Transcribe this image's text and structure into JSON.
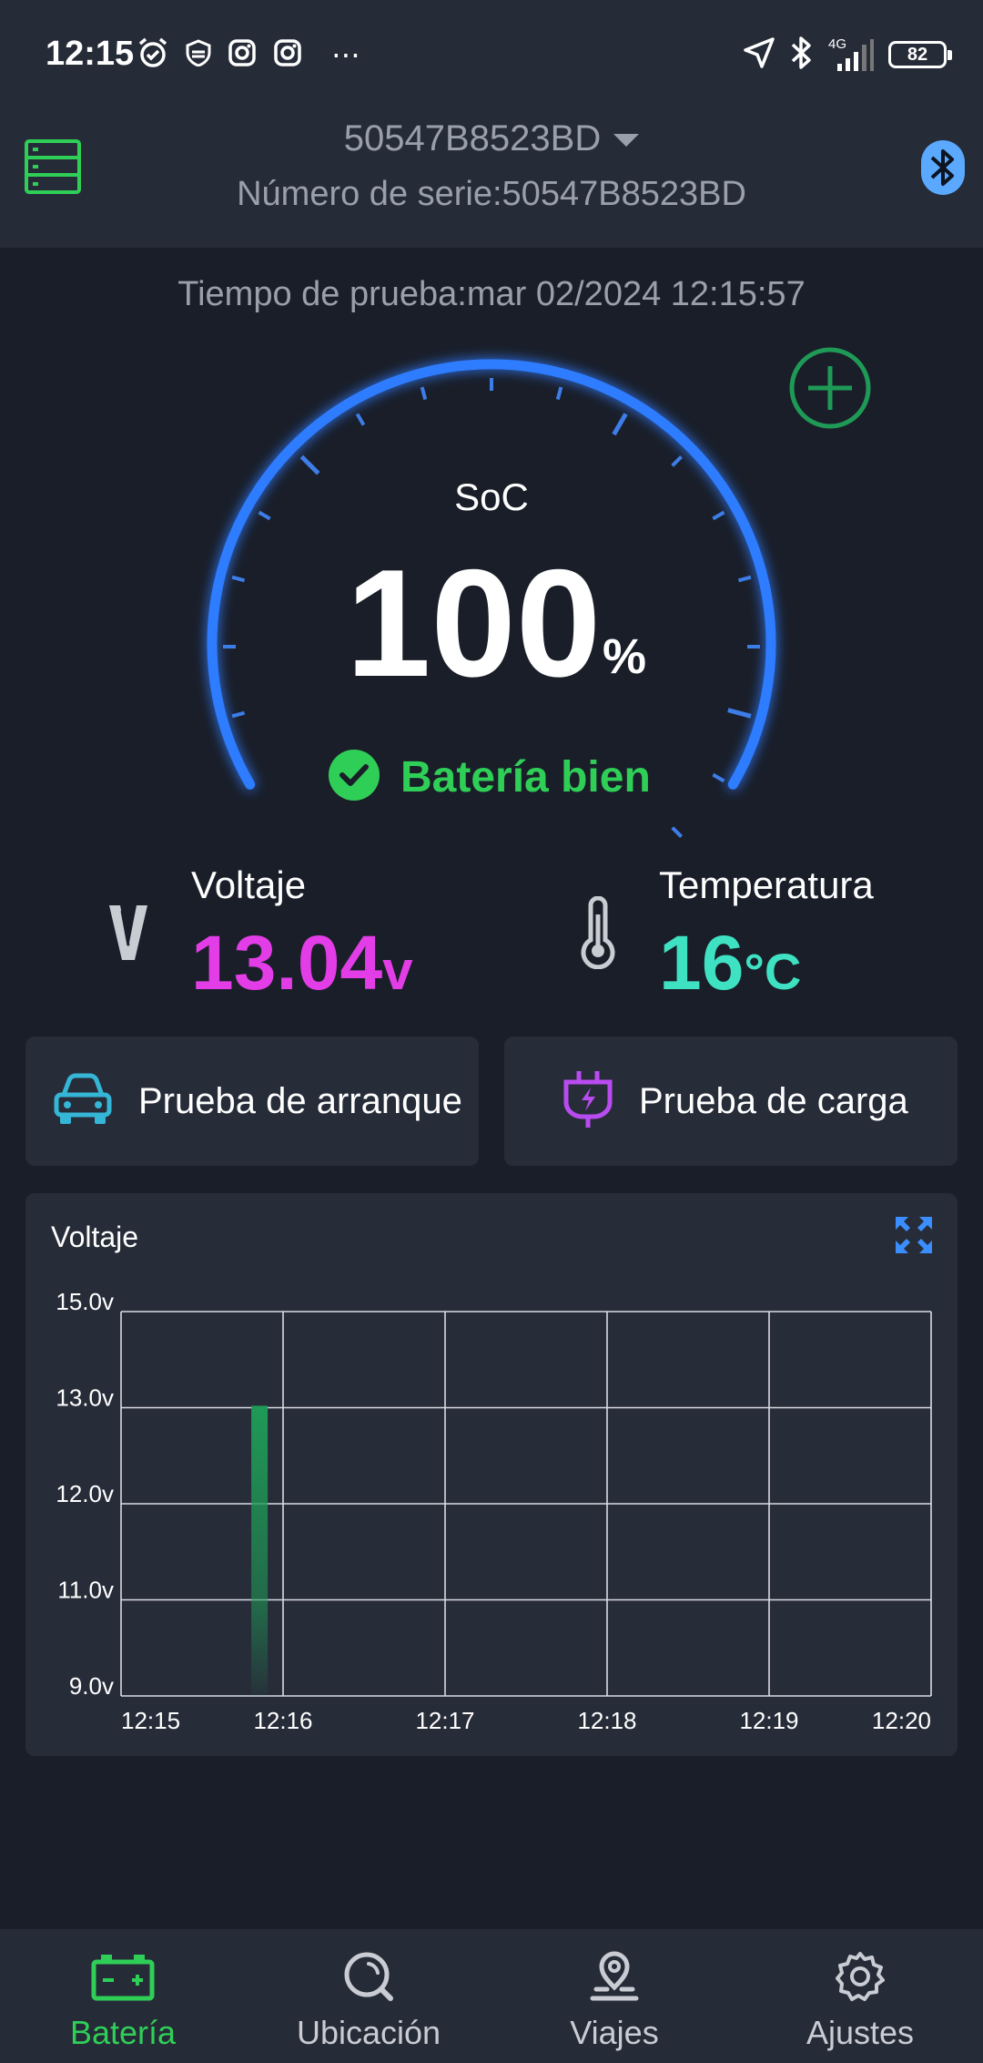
{
  "status_bar": {
    "time": "12:15",
    "network": "4G",
    "battery": "82"
  },
  "header": {
    "device_name": "50547B8523BD",
    "serial": "Número de serie:50547B8523BD"
  },
  "test_time": "Tiempo de prueba:mar 02/2024 12:15:57",
  "gauge": {
    "label": "SoC",
    "value": "100",
    "unit": "%",
    "level": 1.0,
    "status": "Batería bien",
    "accent": "#2f7bff"
  },
  "voltage": {
    "label": "Voltaje",
    "value": "13.04",
    "unit": "v",
    "color": "#e23de6"
  },
  "temperature": {
    "label": "Temperatura",
    "value": "16",
    "unit": "°C",
    "color": "#3ee2c2"
  },
  "actions": {
    "crank_test": "Prueba de arranque",
    "charge_test": "Prueba de carga"
  },
  "chart_data": {
    "type": "bar",
    "title": "Voltaje",
    "y_ticks": [
      "15.0v",
      "13.0v",
      "12.0v",
      "11.0v",
      "9.0v"
    ],
    "x_ticks": [
      "12:15",
      "12:16",
      "12:17",
      "12:18",
      "12:19",
      "12:20"
    ],
    "points": [
      {
        "x": "12:15:57",
        "y": 13.04
      }
    ],
    "xlim": [
      "12:15",
      "12:20"
    ],
    "bar_color": "#1f9a56",
    "grid": true
  },
  "bottom_nav": [
    {
      "label": "Batería",
      "icon": "battery-icon",
      "active": true
    },
    {
      "label": "Ubicación",
      "icon": "search-icon",
      "active": false
    },
    {
      "label": "Viajes",
      "icon": "location-pin-icon",
      "active": false
    },
    {
      "label": "Ajustes",
      "icon": "gear-icon",
      "active": false
    }
  ],
  "colors": {
    "green": "#2fcf57",
    "bluetooth": "#5aa9ff",
    "purple": "#b94cf0",
    "teal": "#35b6d6"
  }
}
